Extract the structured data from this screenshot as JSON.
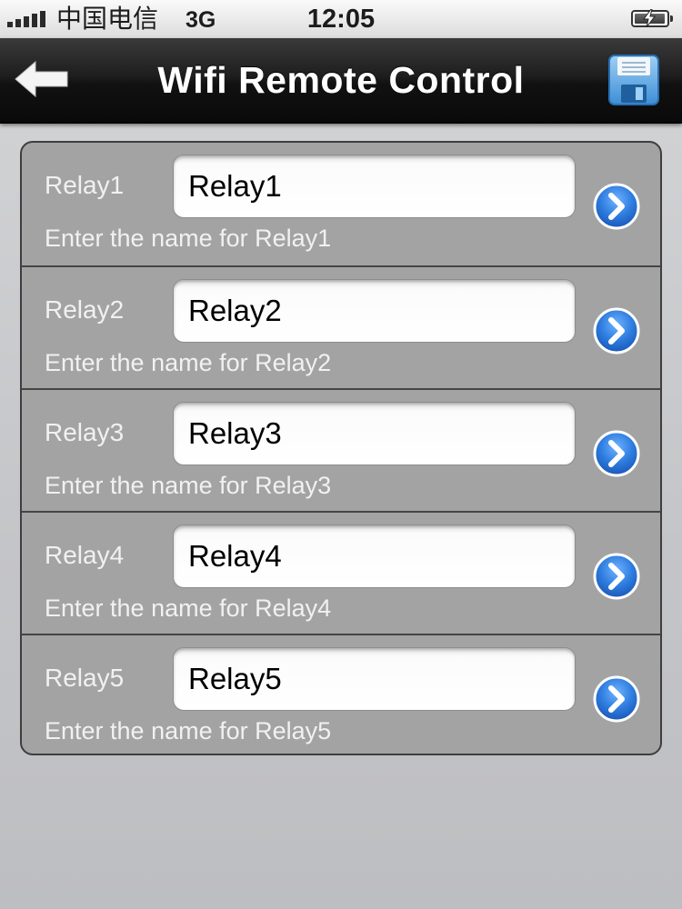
{
  "status_bar": {
    "carrier": "中国电信",
    "network": "3G",
    "time": "12:05"
  },
  "nav_bar": {
    "title": "Wifi Remote Control",
    "back_icon": "back-arrow-icon",
    "save_icon": "floppy-disk-icon"
  },
  "colors": {
    "nav_bar": "#111111",
    "table_background": "#a3a3a4",
    "disclosure_button": "#2f7ee0",
    "label_text": "#f1f1f1"
  },
  "relays": [
    {
      "label": "Relay1",
      "value": "Relay1",
      "hint": "Enter the name for Relay1"
    },
    {
      "label": "Relay2",
      "value": "Relay2",
      "hint": "Enter the name for Relay2"
    },
    {
      "label": "Relay3",
      "value": "Relay3",
      "hint": "Enter the name for Relay3"
    },
    {
      "label": "Relay4",
      "value": "Relay4",
      "hint": "Enter the name for Relay4"
    },
    {
      "label": "Relay5",
      "value": "Relay5",
      "hint": "Enter the name for Relay5"
    }
  ]
}
